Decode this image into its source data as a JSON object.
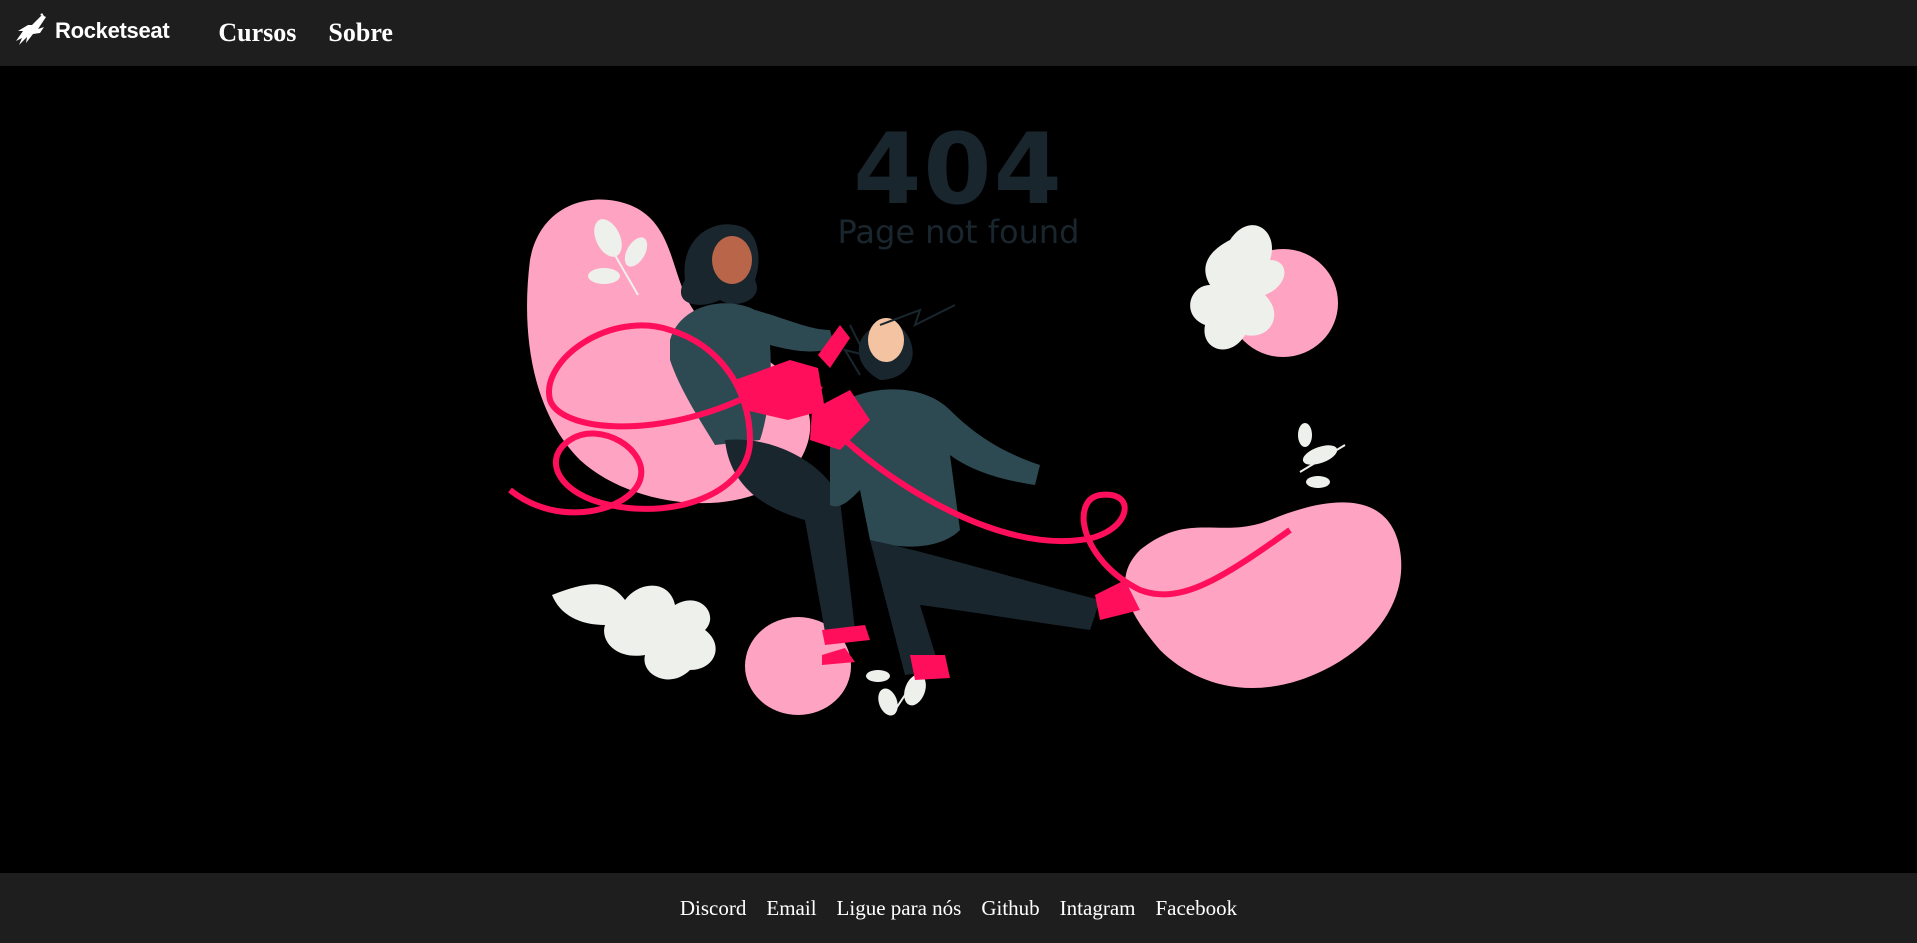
{
  "header": {
    "brand": "Rocketseat",
    "nav": [
      {
        "label": "Cursos"
      },
      {
        "label": "Sobre"
      }
    ]
  },
  "error": {
    "code": "404",
    "message": "Page not found"
  },
  "footer": {
    "links": [
      {
        "label": "Discord"
      },
      {
        "label": "Email"
      },
      {
        "label": "Ligue para nós"
      },
      {
        "label": "Github"
      },
      {
        "label": "Intagram"
      },
      {
        "label": "Facebook"
      }
    ]
  },
  "colors": {
    "bar_background": "#1e1e1e",
    "page_background": "#000000",
    "accent_pink": "#ff0f5b",
    "blob_pink": "#ffa3c2",
    "text_404": "#1a262e",
    "character_dark": "#2d4a52"
  },
  "icons": {
    "brand_logo": "rocket-logo-icon",
    "illustration": "unplugged-cable-illustration"
  }
}
